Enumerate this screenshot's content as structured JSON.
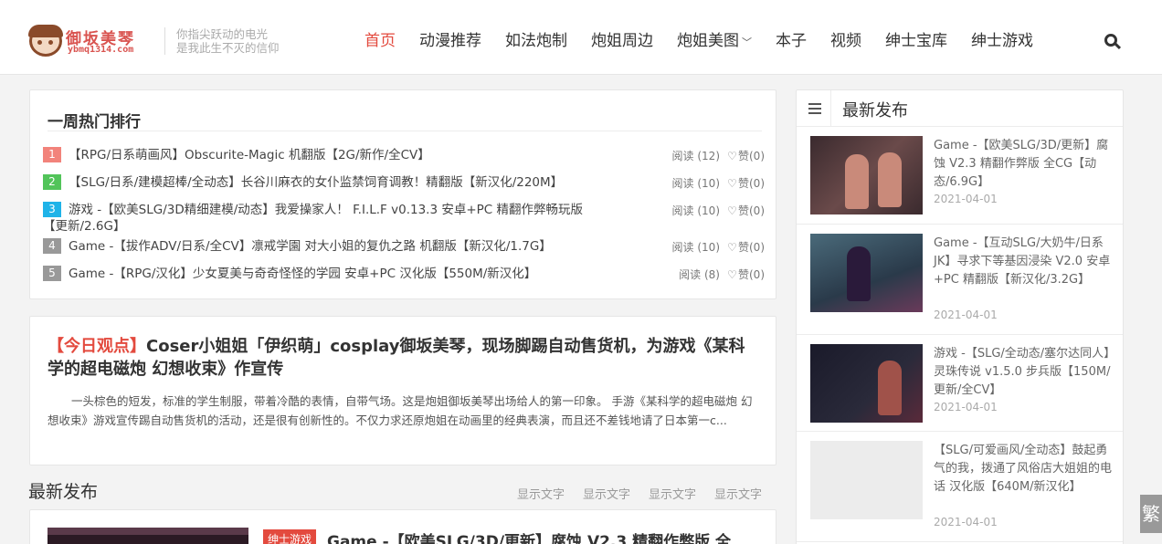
{
  "header": {
    "logo_title": "御坂美琴",
    "logo_sub": "ybmq1314.com",
    "slogan_line1": "你指尖跃动的电光",
    "slogan_line2": "是我此生不灭的信仰",
    "nav": [
      {
        "label": "首页",
        "active": true
      },
      {
        "label": "动漫推荐"
      },
      {
        "label": "如法炮制"
      },
      {
        "label": "炮姐周边"
      },
      {
        "label": "炮姐美图",
        "dropdown": true
      },
      {
        "label": "本子"
      },
      {
        "label": "视频"
      },
      {
        "label": "绅士宝库"
      },
      {
        "label": "绅士游戏"
      }
    ]
  },
  "hot": {
    "title": "一周热门排行",
    "items": [
      {
        "rank": "1",
        "text": "【RPG/日系萌画风】Obscurite-Magic 机翻版【2G/新作/全CV】",
        "reads": "阅读 (12)",
        "likes": "赞(0)"
      },
      {
        "rank": "2",
        "text": "【SLG/日系/建模超棒/全动态】长谷川麻衣的女仆监禁饲育调教！精翻版【新汉化/220M】",
        "reads": "阅读 (10)",
        "likes": "赞(0)"
      },
      {
        "rank": "3",
        "text": "游戏 -【欧美SLG/3D精细建模/动态】我爱操家人！ F.I.L.F v0.13.3 安卓+PC 精翻作弊畅玩版【更新/2.6G】",
        "reads": "阅读 (10)",
        "likes": "赞(0)"
      },
      {
        "rank": "4",
        "text": "Game -【拔作ADV/日系/全CV】凛戒学園 对大小姐的复仇之路 机翻版【新汉化/1.7G】",
        "reads": "阅读 (10)",
        "likes": "赞(0)"
      },
      {
        "rank": "5",
        "text": "Game -【RPG/汉化】少女夏美与奇奇怪怪的学园 安卓+PC 汉化版【550M/新汉化】",
        "reads": "阅读 (8)",
        "likes": "赞(0)"
      }
    ]
  },
  "viewpoint": {
    "tag": "【今日观点】",
    "title": "Coser小姐姐「伊织萌」cosplay御坂美琴，现场脚踢自动售货机，为游戏《某科学的超电磁炮 幻想收束》作宣传",
    "body": "一头棕色的短发，标准的学生制服，带着冷酷的表情，自带气场。这是炮姐御坂美琴出场给人的第一印象。 手游《某科学的超电磁炮 幻想收束》游戏宣传踢自动售货机的活动，还是很有创新性的。不仅力求还原炮姐在动画里的经典表演，而且还不差钱地请了日本第一c..."
  },
  "latest": {
    "title": "最新发布",
    "tabs": [
      "显示文字",
      "显示文字",
      "显示文字",
      "显示文字"
    ],
    "post": {
      "badge": "绅士游戏",
      "title": "Game -【欧美SLG/3D/更新】腐蚀 V2.3 精翻作弊版 全"
    }
  },
  "sidebar": {
    "title": "最新发布",
    "items": [
      {
        "text": "Game -【欧美SLG/3D/更新】腐蚀 V2.3 精翻作弊版 全CG【动态/6.9G】",
        "date": "2021-04-01"
      },
      {
        "text": "Game -【互动SLG/大奶牛/日系JK】寻求下等基因浸染 V2.0 安卓+PC 精翻版【新汉化/3.2G】",
        "date": "2021-04-01"
      },
      {
        "text": "游戏 -【SLG/全动态/塞尔达同人】灵珠传说 v1.5.0 步兵版【150M/更新/全CV】",
        "date": "2021-04-01"
      },
      {
        "text": "【SLG/可爱画风/全动态】鼓起勇气的我，拨通了风俗店大姐姐的电话 汉化版【640M/新汉化】",
        "date": "2021-04-01"
      }
    ]
  },
  "float_btn": "繁",
  "colors": {
    "accent": "#e34a3e",
    "rank1": "#f2837b",
    "rank2": "#52c45a",
    "rank3": "#1fb3e8",
    "rank_other": "#999999"
  }
}
